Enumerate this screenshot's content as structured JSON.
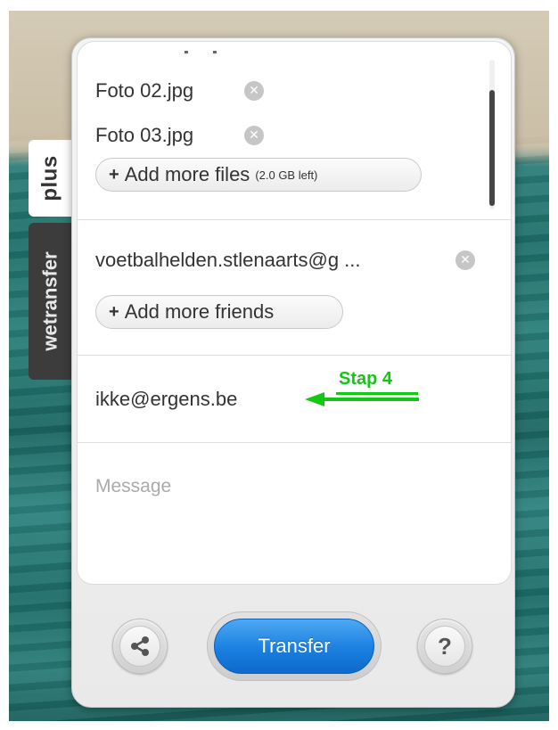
{
  "side_tabs": {
    "plus_label": "plus",
    "wetransfer_label": "wetransfer"
  },
  "files": {
    "partial_item": "",
    "items": [
      {
        "name": "Foto 02.jpg"
      },
      {
        "name": "Foto 03.jpg"
      }
    ],
    "add_more_label": "Add more files",
    "add_more_plus": "+",
    "space_left": "(2.0 GB left)"
  },
  "friends": {
    "items": [
      {
        "email": "voetbalhelden.stlenaarts@g ..."
      }
    ],
    "add_more_label": "Add more friends",
    "add_more_plus": "+"
  },
  "sender": {
    "email": "ikke@ergens.be"
  },
  "annotation": {
    "text": "Stap 4",
    "color": "#12c812"
  },
  "message": {
    "placeholder": "Message",
    "value": ""
  },
  "toolbar": {
    "transfer_label": "Transfer",
    "help_label": "?"
  },
  "colors": {
    "accent": "#1a7fe0",
    "annotation": "#12c812",
    "tab_dark": "#3c3c3c"
  },
  "icons": {
    "remove": "close-circle-icon",
    "share": "share-icon",
    "help": "help-icon"
  }
}
